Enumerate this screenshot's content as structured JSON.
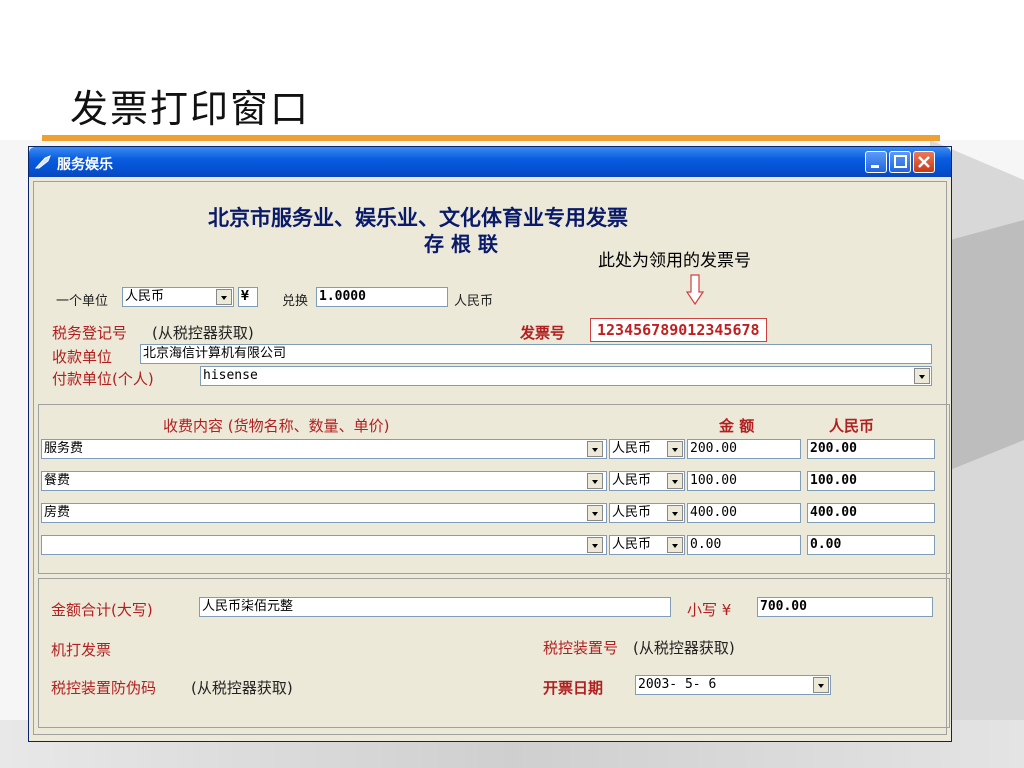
{
  "slide": {
    "title": "发票打印窗口",
    "accent": "#f0a030"
  },
  "window": {
    "title": "服务娱乐"
  },
  "invoice": {
    "heading": "北京市服务业、娱乐业、文化体育业专用发票",
    "subheading": "存 根 联",
    "annotation": "此处为领用的发票号",
    "currency_unit_label": "一个单位",
    "currency": "人民币",
    "yuan_symbol": "¥",
    "exchange_label": "兑换",
    "exchange_rate": "1.0000",
    "exchange_unit": "人民币",
    "tax_reg_label": "税务登记号",
    "tax_reg_note": "(从税控器获取)",
    "invoice_no_label": "发票号",
    "invoice_no": "123456789012345678",
    "payee_label": "收款单位",
    "payee": "北京海信计算机有限公司",
    "payer_label": "付款单位(个人)",
    "payer": "hisense"
  },
  "items": {
    "header_desc": "收费内容 (货物名称、数量、单价)",
    "header_amount": "金  额",
    "header_rmb": "人民币",
    "rows": [
      {
        "desc": "服务费",
        "currency": "人民币",
        "amount": "200.00",
        "rmb": "200.00"
      },
      {
        "desc": "餐费",
        "currency": "人民币",
        "amount": "100.00",
        "rmb": "100.00"
      },
      {
        "desc": "房费",
        "currency": "人民币",
        "amount": "400.00",
        "rmb": "400.00"
      },
      {
        "desc": "",
        "currency": "人民币",
        "amount": "0.00",
        "rmb": "0.00"
      }
    ]
  },
  "totals": {
    "total_label": "金额合计(大写)",
    "total_words": "人民币柒佰元整",
    "small_label": "小写 ¥",
    "small_value": "700.00",
    "machine_label": "机打发票",
    "device_no_label": "税控装置号",
    "device_no_note": "(从税控器获取)",
    "anti_fake_label": "税控装置防伪码",
    "anti_fake_note": "(从税控器获取)",
    "date_label": "开票日期",
    "date_value": "2003- 5- 6"
  }
}
